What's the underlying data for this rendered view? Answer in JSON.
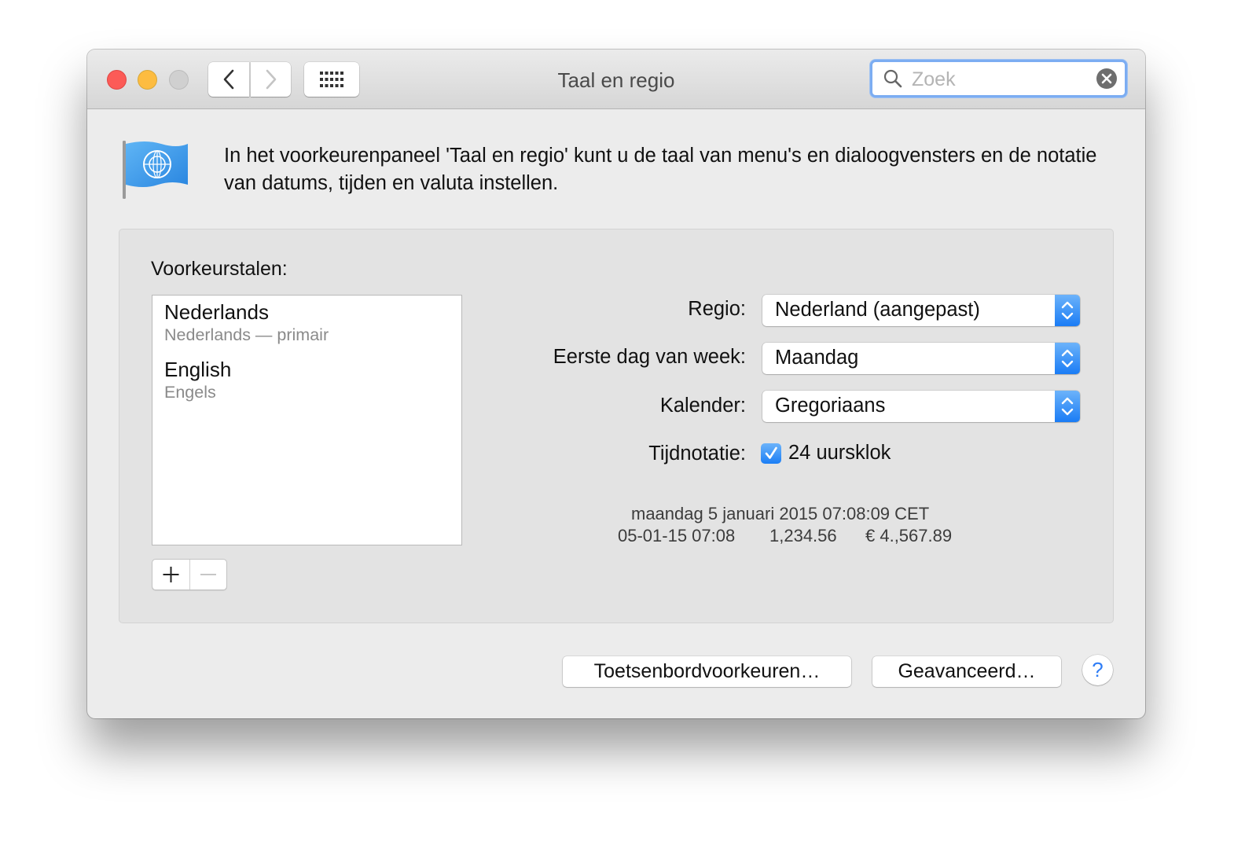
{
  "window": {
    "title": "Taal en regio"
  },
  "search": {
    "placeholder": "Zoek",
    "value": ""
  },
  "intro": "In het voorkeurenpaneel 'Taal en regio' kunt u de taal van menu's en dialoogvensters en de notatie van datums, tijden en valuta instellen.",
  "languages": {
    "heading": "Voorkeurstalen:",
    "items": [
      {
        "name": "Nederlands",
        "subtitle": "Nederlands — primair"
      },
      {
        "name": "English",
        "subtitle": "Engels"
      }
    ]
  },
  "settings": {
    "region": {
      "label": "Regio:",
      "value": "Nederland (aangepast)"
    },
    "first_day": {
      "label": "Eerste dag van week:",
      "value": "Maandag"
    },
    "calendar": {
      "label": "Kalender:",
      "value": "Gregoriaans"
    },
    "time_format": {
      "label": "Tijdnotatie:",
      "checkbox_label": "24 uursklok",
      "checked": true
    }
  },
  "sample": {
    "long_date": "maandag 5 januari 2015 07:08:09 CET",
    "short_date": "05-01-15 07:08",
    "number": "1,234.56",
    "currency": "€ 4.,567.89"
  },
  "buttons": {
    "keyboard": "Toetsenbordvoorkeuren…",
    "advanced": "Geavanceerd…",
    "help": "?"
  },
  "colors": {
    "accent": "#1b7ef5",
    "close": "#fc5b57",
    "minimize": "#fdbc40",
    "zoom_disabled": "#d0d0d0"
  }
}
